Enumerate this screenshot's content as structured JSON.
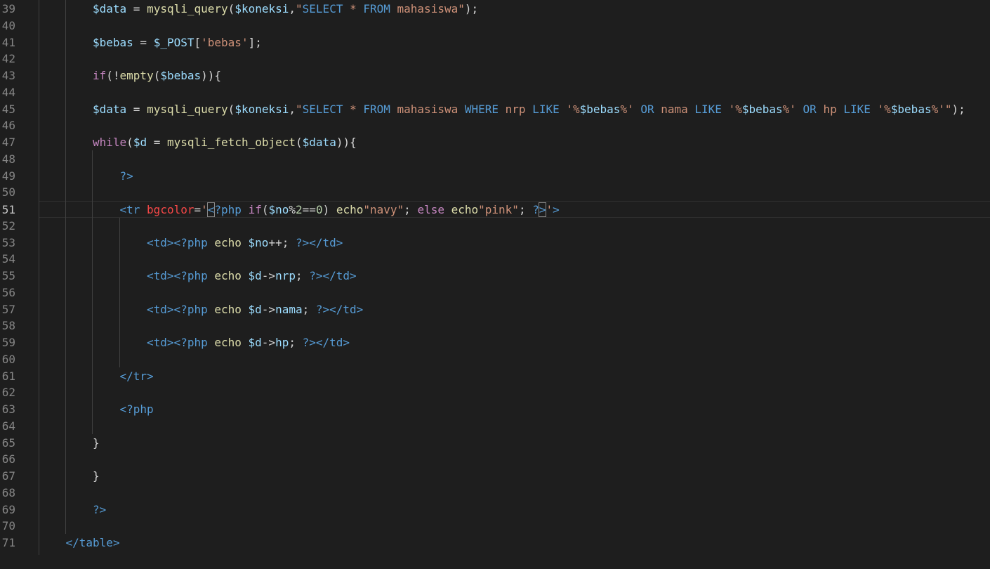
{
  "editor": {
    "lines": [
      {
        "n": "39",
        "indent": 2,
        "tokens": [
          [
            "var",
            "$data"
          ],
          [
            "punc",
            " = "
          ],
          [
            "fn",
            "mysqli_query"
          ],
          [
            "punc",
            "("
          ],
          [
            "var",
            "$koneksi"
          ],
          [
            "punc",
            ","
          ],
          [
            "str",
            "\""
          ],
          [
            "sql",
            "SELECT"
          ],
          [
            "str",
            " * "
          ],
          [
            "sql",
            "FROM"
          ],
          [
            "str",
            " mahasiswa\""
          ],
          [
            "punc",
            ");"
          ]
        ]
      },
      {
        "n": "40",
        "indent": 0,
        "tokens": []
      },
      {
        "n": "41",
        "indent": 2,
        "tokens": [
          [
            "var",
            "$bebas"
          ],
          [
            "punc",
            " = "
          ],
          [
            "var",
            "$_POST"
          ],
          [
            "punc",
            "["
          ],
          [
            "str",
            "'bebas'"
          ],
          [
            "punc",
            "];"
          ]
        ]
      },
      {
        "n": "42",
        "indent": 0,
        "tokens": []
      },
      {
        "n": "43",
        "indent": 2,
        "tokens": [
          [
            "kw",
            "if"
          ],
          [
            "punc",
            "(!"
          ],
          [
            "fn",
            "empty"
          ],
          [
            "punc",
            "("
          ],
          [
            "var",
            "$bebas"
          ],
          [
            "punc",
            "))"
          ],
          [
            "punc",
            "{"
          ]
        ]
      },
      {
        "n": "44",
        "indent": 0,
        "tokens": []
      },
      {
        "n": "45",
        "indent": 2,
        "tokens": [
          [
            "var",
            "$data"
          ],
          [
            "punc",
            " = "
          ],
          [
            "fn",
            "mysqli_query"
          ],
          [
            "punc",
            "("
          ],
          [
            "var",
            "$koneksi"
          ],
          [
            "punc",
            ","
          ],
          [
            "str",
            "\""
          ],
          [
            "sql",
            "SELECT"
          ],
          [
            "str",
            " * "
          ],
          [
            "sql",
            "FROM"
          ],
          [
            "str",
            " mahasiswa "
          ],
          [
            "sql",
            "WHERE"
          ],
          [
            "str",
            " nrp "
          ],
          [
            "sql",
            "LIKE"
          ],
          [
            "str",
            " '%"
          ],
          [
            "var",
            "$bebas"
          ],
          [
            "str",
            "%' "
          ],
          [
            "sql",
            "OR"
          ],
          [
            "str",
            " nama "
          ],
          [
            "sql",
            "LIKE"
          ],
          [
            "str",
            " '%"
          ],
          [
            "var",
            "$bebas"
          ],
          [
            "str",
            "%' "
          ],
          [
            "sql",
            "OR"
          ],
          [
            "str",
            " hp "
          ],
          [
            "sql",
            "LIKE"
          ],
          [
            "str",
            " '%"
          ],
          [
            "var",
            "$bebas"
          ],
          [
            "str",
            "%'\""
          ],
          [
            "punc",
            ");"
          ]
        ]
      },
      {
        "n": "46",
        "indent": 0,
        "tokens": []
      },
      {
        "n": "47",
        "indent": 2,
        "tokens": [
          [
            "kw",
            "while"
          ],
          [
            "punc",
            "("
          ],
          [
            "var",
            "$d"
          ],
          [
            "punc",
            " = "
          ],
          [
            "fn",
            "mysqli_fetch_object"
          ],
          [
            "punc",
            "("
          ],
          [
            "var",
            "$data"
          ],
          [
            "punc",
            "))"
          ],
          [
            "punc",
            "{"
          ]
        ]
      },
      {
        "n": "48",
        "indent": 0,
        "tokens": []
      },
      {
        "n": "49",
        "indent": 3,
        "tokens": [
          [
            "tag",
            "?>"
          ]
        ]
      },
      {
        "n": "50",
        "indent": 0,
        "tokens": []
      },
      {
        "n": "51",
        "indent": 3,
        "current": true,
        "tokens": [
          [
            "tag",
            "<"
          ],
          [
            "tagname",
            "tr"
          ],
          [
            "punc",
            " "
          ],
          [
            "attr",
            "bgcolor"
          ],
          [
            "punc",
            "="
          ],
          [
            "str",
            "'"
          ],
          [
            "tagbox",
            "<"
          ],
          [
            "tag",
            "?php"
          ],
          [
            "punc",
            " "
          ],
          [
            "kw",
            "if"
          ],
          [
            "punc",
            "("
          ],
          [
            "var",
            "$no"
          ],
          [
            "punc",
            "%"
          ],
          [
            "num",
            "2"
          ],
          [
            "punc",
            "=="
          ],
          [
            "num",
            "0"
          ],
          [
            "punc",
            ") "
          ],
          [
            "fn",
            "echo"
          ],
          [
            "str",
            "\"navy\""
          ],
          [
            "punc",
            "; "
          ],
          [
            "kw",
            "else"
          ],
          [
            "punc",
            " "
          ],
          [
            "fn",
            "echo"
          ],
          [
            "str",
            "\"pink\""
          ],
          [
            "punc",
            "; "
          ],
          [
            "tag",
            "?"
          ],
          [
            "tagbox",
            ">"
          ],
          [
            "str",
            "'"
          ],
          [
            "tag",
            ">"
          ]
        ]
      },
      {
        "n": "52",
        "indent": 0,
        "tokens": []
      },
      {
        "n": "53",
        "indent": 4,
        "tokens": [
          [
            "tag",
            "<"
          ],
          [
            "tagname",
            "td"
          ],
          [
            "tag",
            ">"
          ],
          [
            "tag",
            "<?php"
          ],
          [
            "punc",
            " "
          ],
          [
            "fn",
            "echo"
          ],
          [
            "punc",
            " "
          ],
          [
            "var",
            "$no"
          ],
          [
            "punc",
            "++; "
          ],
          [
            "tag",
            "?>"
          ],
          [
            "tag",
            "</"
          ],
          [
            "tagname",
            "td"
          ],
          [
            "tag",
            ">"
          ]
        ]
      },
      {
        "n": "54",
        "indent": 0,
        "tokens": []
      },
      {
        "n": "55",
        "indent": 4,
        "tokens": [
          [
            "tag",
            "<"
          ],
          [
            "tagname",
            "td"
          ],
          [
            "tag",
            ">"
          ],
          [
            "tag",
            "<?php"
          ],
          [
            "punc",
            " "
          ],
          [
            "fn",
            "echo"
          ],
          [
            "punc",
            " "
          ],
          [
            "var",
            "$d"
          ],
          [
            "punc",
            "->"
          ],
          [
            "var",
            "nrp"
          ],
          [
            "punc",
            "; "
          ],
          [
            "tag",
            "?>"
          ],
          [
            "tag",
            "</"
          ],
          [
            "tagname",
            "td"
          ],
          [
            "tag",
            ">"
          ]
        ]
      },
      {
        "n": "56",
        "indent": 0,
        "tokens": []
      },
      {
        "n": "57",
        "indent": 4,
        "tokens": [
          [
            "tag",
            "<"
          ],
          [
            "tagname",
            "td"
          ],
          [
            "tag",
            ">"
          ],
          [
            "tag",
            "<?php"
          ],
          [
            "punc",
            " "
          ],
          [
            "fn",
            "echo"
          ],
          [
            "punc",
            " "
          ],
          [
            "var",
            "$d"
          ],
          [
            "punc",
            "->"
          ],
          [
            "var",
            "nama"
          ],
          [
            "punc",
            "; "
          ],
          [
            "tag",
            "?>"
          ],
          [
            "tag",
            "</"
          ],
          [
            "tagname",
            "td"
          ],
          [
            "tag",
            ">"
          ]
        ]
      },
      {
        "n": "58",
        "indent": 0,
        "tokens": []
      },
      {
        "n": "59",
        "indent": 4,
        "tokens": [
          [
            "tag",
            "<"
          ],
          [
            "tagname",
            "td"
          ],
          [
            "tag",
            ">"
          ],
          [
            "tag",
            "<?php"
          ],
          [
            "punc",
            " "
          ],
          [
            "fn",
            "echo"
          ],
          [
            "punc",
            " "
          ],
          [
            "var",
            "$d"
          ],
          [
            "punc",
            "->"
          ],
          [
            "var",
            "hp"
          ],
          [
            "punc",
            "; "
          ],
          [
            "tag",
            "?>"
          ],
          [
            "tag",
            "</"
          ],
          [
            "tagname",
            "td"
          ],
          [
            "tag",
            ">"
          ]
        ]
      },
      {
        "n": "60",
        "indent": 0,
        "tokens": []
      },
      {
        "n": "61",
        "indent": 3,
        "tokens": [
          [
            "tag",
            "</"
          ],
          [
            "tagname",
            "tr"
          ],
          [
            "tag",
            ">"
          ]
        ]
      },
      {
        "n": "62",
        "indent": 0,
        "tokens": []
      },
      {
        "n": "63",
        "indent": 3,
        "tokens": [
          [
            "tag",
            "<?php"
          ]
        ]
      },
      {
        "n": "64",
        "indent": 0,
        "tokens": []
      },
      {
        "n": "65",
        "indent": 2,
        "tokens": [
          [
            "punc",
            "}"
          ]
        ]
      },
      {
        "n": "66",
        "indent": 0,
        "tokens": []
      },
      {
        "n": "67",
        "indent": 2,
        "tokens": [
          [
            "punc",
            "}"
          ]
        ]
      },
      {
        "n": "68",
        "indent": 0,
        "tokens": []
      },
      {
        "n": "69",
        "indent": 2,
        "tokens": [
          [
            "tag",
            "?>"
          ]
        ]
      },
      {
        "n": "70",
        "indent": 0,
        "tokens": []
      },
      {
        "n": "71",
        "indent": 1,
        "tokens": [
          [
            "tag",
            "</"
          ],
          [
            "tagname",
            "table"
          ],
          [
            "tag",
            ">"
          ]
        ]
      }
    ]
  }
}
